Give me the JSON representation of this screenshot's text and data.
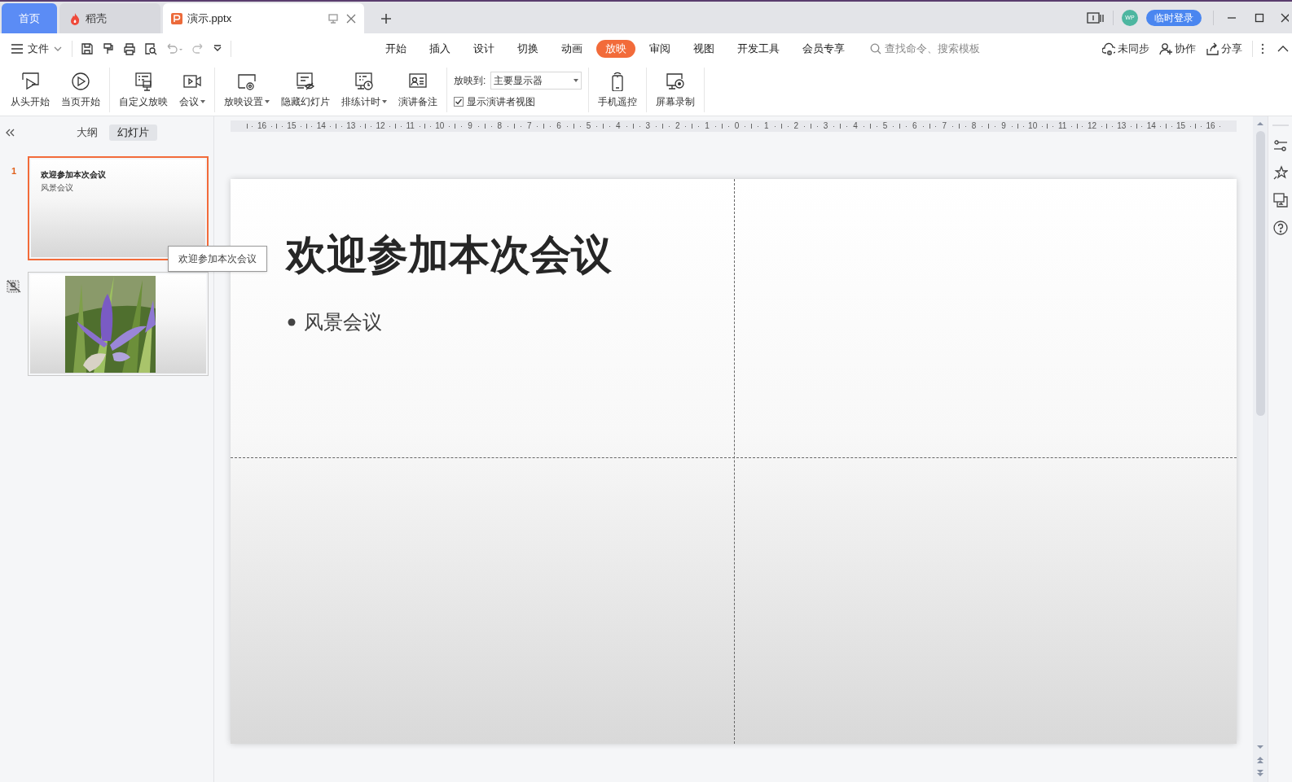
{
  "tabs": [
    {
      "label": "首页",
      "kind": "home",
      "selected": false
    },
    {
      "label": "稻壳",
      "kind": "docer",
      "selected": false
    },
    {
      "label": "演示.pptx",
      "kind": "doc",
      "selected": true
    }
  ],
  "account": {
    "avatar": "WP",
    "login": "临时登录"
  },
  "menu": {
    "file": "文件",
    "ribbon_tabs": [
      {
        "label": "开始",
        "selected": false
      },
      {
        "label": "插入",
        "selected": false
      },
      {
        "label": "设计",
        "selected": false
      },
      {
        "label": "切换",
        "selected": false
      },
      {
        "label": "动画",
        "selected": false
      },
      {
        "label": "放映",
        "selected": true
      },
      {
        "label": "审阅",
        "selected": false
      },
      {
        "label": "视图",
        "selected": false
      },
      {
        "label": "开发工具",
        "selected": false
      },
      {
        "label": "会员专享",
        "selected": false
      }
    ],
    "search": {
      "placeholder": "查找命令、搜索模板"
    },
    "actions": [
      {
        "label": "未同步",
        "kind": "cloud"
      },
      {
        "label": "协作",
        "kind": "person"
      },
      {
        "label": "分享",
        "kind": "share"
      }
    ]
  },
  "ribbon": {
    "groups": [
      [
        {
          "label": "从头开始",
          "kind": "play-start",
          "dropdown": false
        },
        {
          "label": "当页开始",
          "kind": "play",
          "dropdown": false
        }
      ],
      [
        {
          "label": "自定义放映",
          "kind": "custom",
          "dropdown": false
        },
        {
          "label": "会议",
          "kind": "meeting",
          "dropdown": true
        }
      ],
      [
        {
          "label": "放映设置",
          "kind": "settings",
          "dropdown": true
        },
        {
          "label": "隐藏幻灯片",
          "kind": "hide",
          "dropdown": false
        },
        {
          "label": "排练计时",
          "kind": "timer",
          "dropdown": true
        },
        {
          "label": "演讲备注",
          "kind": "notes",
          "dropdown": false
        }
      ],
      [
        {
          "label": "手机遥控",
          "kind": "phone",
          "dropdown": false
        }
      ],
      [
        {
          "label": "屏幕录制",
          "kind": "record",
          "dropdown": false
        }
      ]
    ],
    "display": {
      "label": "放映到:",
      "value": "主要显示器"
    },
    "presenter_view": {
      "label": "显示演讲者视图",
      "checked": true
    }
  },
  "panel": {
    "views": [
      {
        "label": "大纲",
        "selected": false
      },
      {
        "label": "幻灯片",
        "selected": true
      }
    ],
    "slides": [
      {
        "number": "1",
        "kind": "text",
        "selected": true,
        "hidden": false,
        "title": "欢迎参加本次会议",
        "bullet": "风景会议"
      },
      {
        "kind": "picture",
        "selected": false,
        "hidden": true
      }
    ],
    "tooltip": "欢迎参加本次会议"
  },
  "ruler": [
    "16",
    "15",
    "14",
    "13",
    "12",
    "11",
    "10",
    "9",
    "8",
    "7",
    "6",
    "5",
    "4",
    "3",
    "2",
    "1",
    "0",
    "1",
    "2",
    "3",
    "4",
    "5",
    "6",
    "7",
    "8",
    "9",
    "10",
    "11",
    "12",
    "13",
    "14",
    "15",
    "16"
  ],
  "slide": {
    "title": "欢迎参加本次会议",
    "bullets": [
      "风景会议"
    ]
  }
}
